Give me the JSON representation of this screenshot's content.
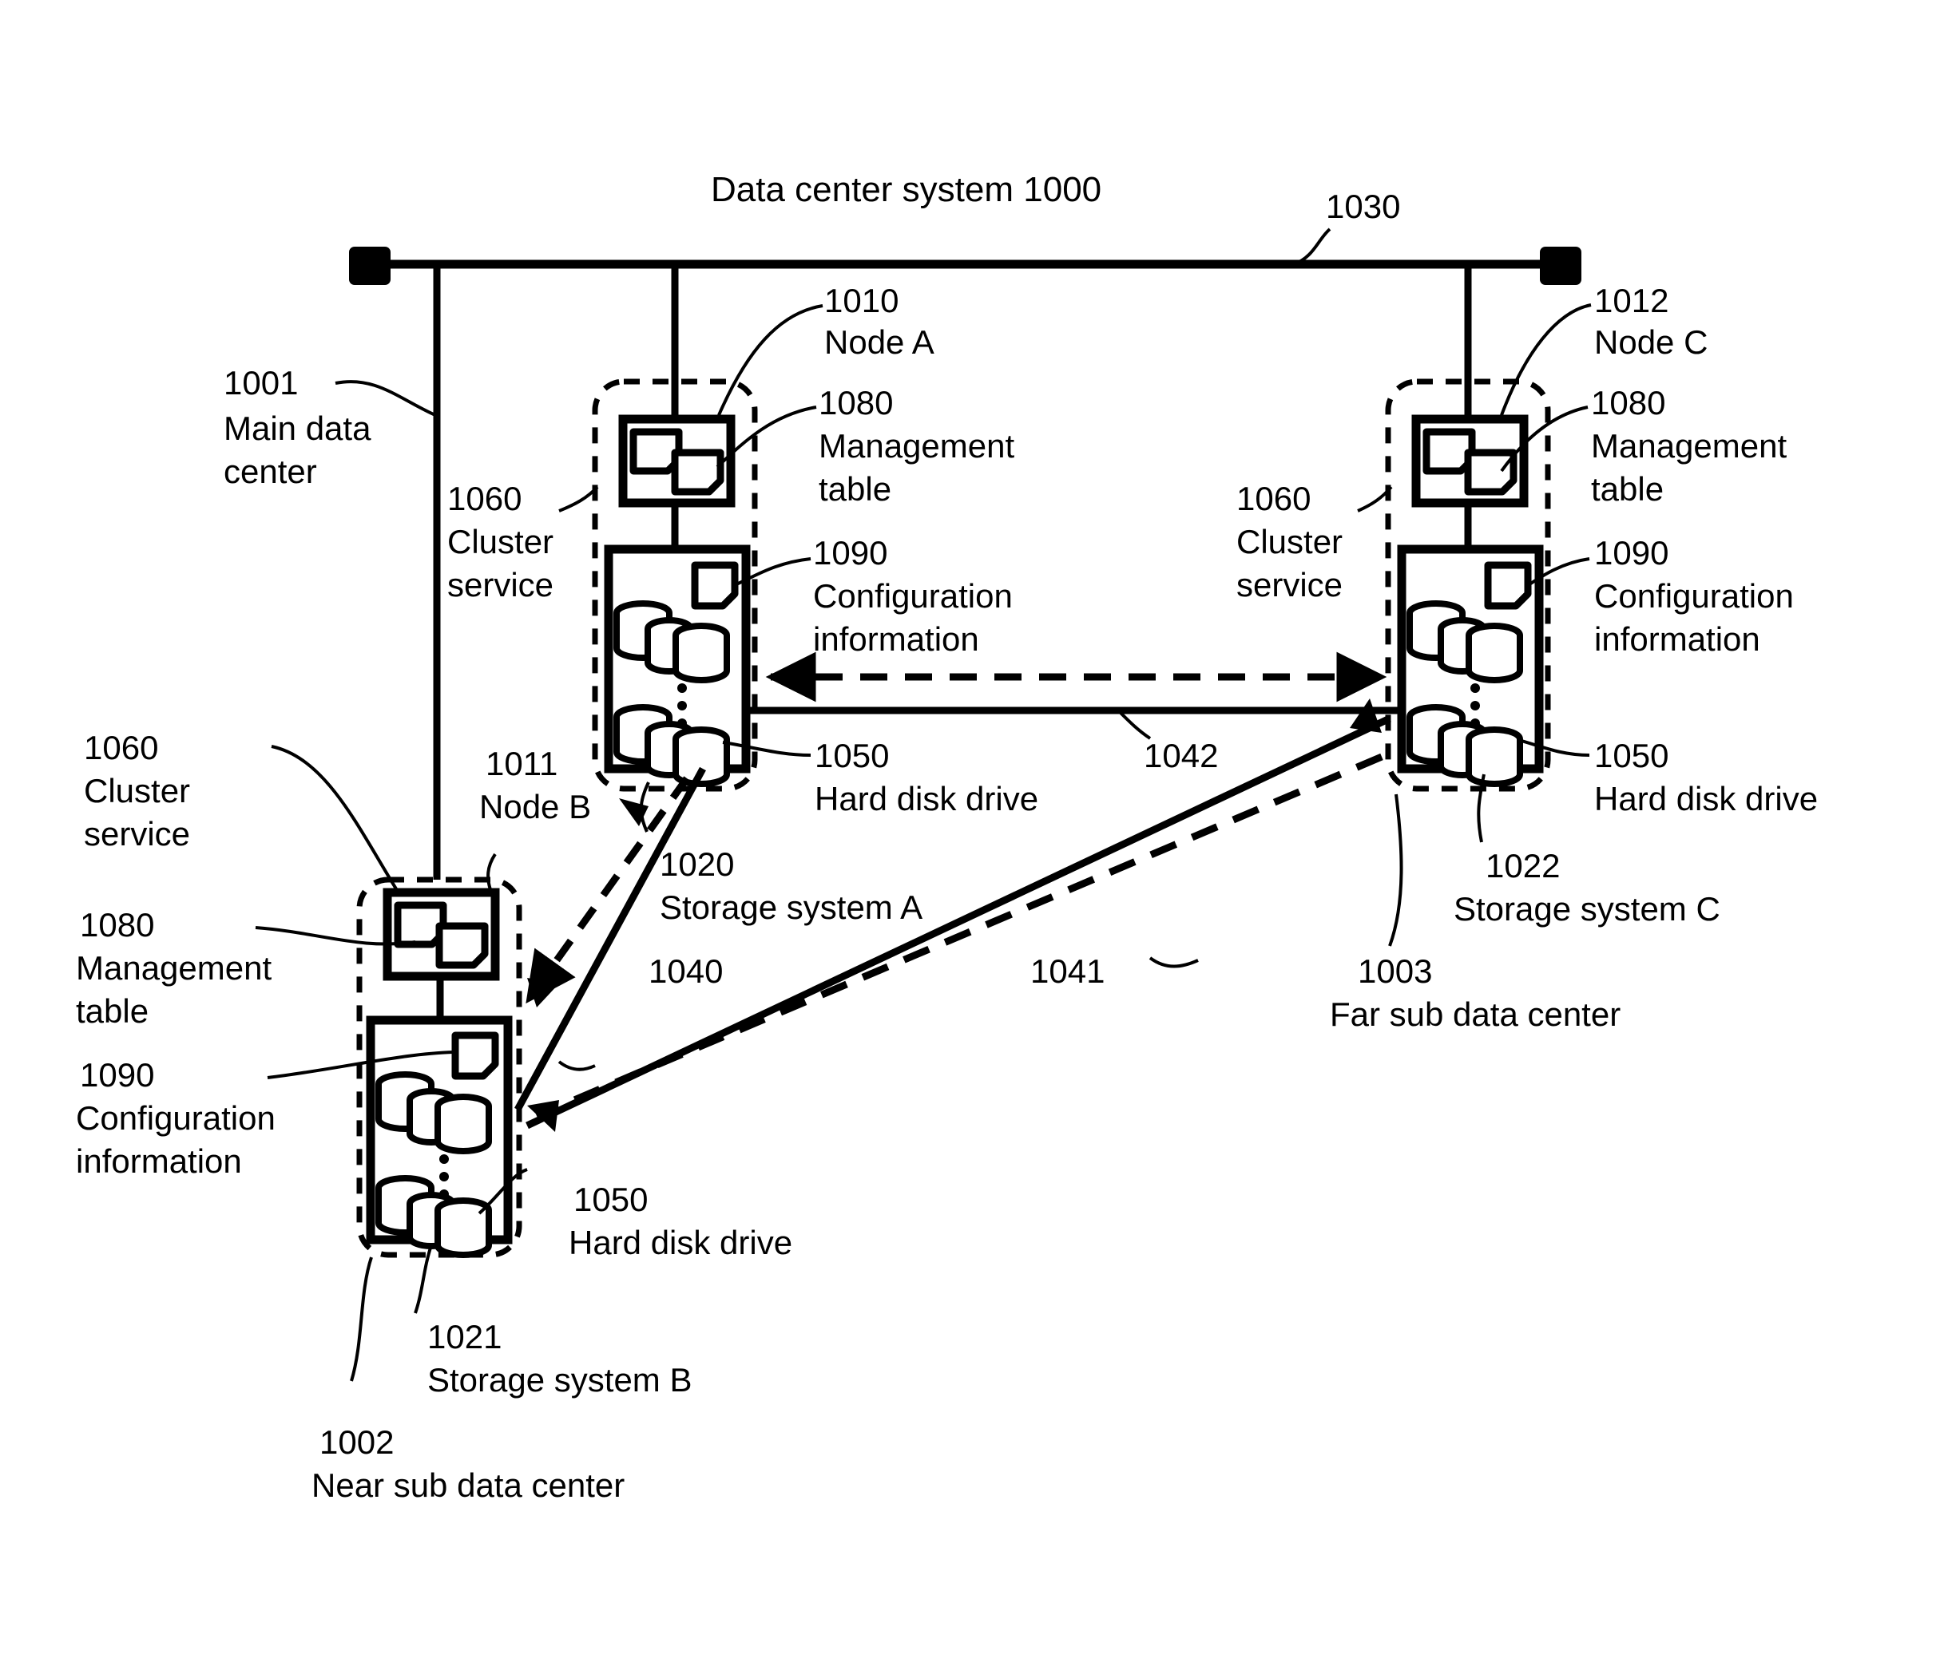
{
  "figure": {
    "title": "Data center system 1000",
    "kind": "patent-block-diagram"
  },
  "network": {
    "bus_ref": "1030",
    "terminator_left": "bus-terminator-left",
    "terminator_right": "bus-terminator-right"
  },
  "datacenters": [
    {
      "ref": "1001",
      "name": "Main data center",
      "line2": ""
    },
    {
      "ref": "1002",
      "name": "Near sub data center",
      "line2": ""
    },
    {
      "ref": "1003",
      "name": "Far sub data center",
      "line2": ""
    }
  ],
  "nodes": [
    {
      "ref": "1010",
      "name": "Node A"
    },
    {
      "ref": "1011",
      "name": "Node B"
    },
    {
      "ref": "1012",
      "name": "Node C"
    }
  ],
  "storage_systems": [
    {
      "ref": "1020",
      "name": "Storage system A"
    },
    {
      "ref": "1021",
      "name": "Storage system B"
    },
    {
      "ref": "1022",
      "name": "Storage system C"
    }
  ],
  "components": {
    "cluster_service": {
      "ref": "1060",
      "name_l1": "Cluster",
      "name_l2": "service"
    },
    "management_table": {
      "ref": "1080",
      "name_l1": "Management",
      "name_l2": "table"
    },
    "config_info": {
      "ref": "1090",
      "name_l1": "Configuration",
      "name_l2": "information"
    },
    "hard_disk_drive": {
      "ref": "1050",
      "name_l1": "Hard disk drive",
      "name_l2": ""
    }
  },
  "links": [
    {
      "ref": "1040",
      "style": "solid",
      "desc": "Storage system A to Storage system B"
    },
    {
      "ref": "1041",
      "style": "dashed",
      "desc": "Storage system B to Storage system C"
    },
    {
      "ref": "1042",
      "style": "dashed",
      "desc": "Storage system A to Storage system C"
    }
  ],
  "labels": {
    "title": "Data center system 1000",
    "ref_1030": "1030",
    "ref_1010": "1010",
    "node_a": "Node A",
    "ref_1012": "1012",
    "node_c": "Node C",
    "ref_1001": "1001",
    "main_dc_l1": "Main data",
    "main_dc_l2": "center",
    "ref_1060_a": "1060",
    "cluster_a_l1": "Cluster",
    "cluster_a_l2": "service",
    "ref_1080_a": "1080",
    "mgmt_a_l1": "Management",
    "mgmt_a_l2": "table",
    "ref_1090_a": "1090",
    "cfg_a_l1": "Configuration",
    "cfg_a_l2": "information",
    "ref_1050_a": "1050",
    "hdd_a": "Hard disk drive",
    "ref_1020": "1020",
    "storage_a": "Storage system A",
    "ref_1060_c": "1060",
    "cluster_c_l1": "Cluster",
    "cluster_c_l2": "service",
    "ref_1080_c": "1080",
    "mgmt_c_l1": "Management",
    "mgmt_c_l2": "table",
    "ref_1090_c": "1090",
    "cfg_c_l1": "Configuration",
    "cfg_c_l2": "information",
    "ref_1050_c": "1050",
    "hdd_c": "Hard disk drive",
    "ref_1022": "1022",
    "storage_c": "Storage system C",
    "ref_1003": "1003",
    "far_dc": "Far sub data center",
    "ref_1060_b": "1060",
    "cluster_b_l1": "Cluster",
    "cluster_b_l2": "service",
    "ref_1011": "1011",
    "node_b": "Node B",
    "ref_1080_b": "1080",
    "mgmt_b_l1": "Management",
    "mgmt_b_l2": "table",
    "ref_1090_b": "1090",
    "cfg_b_l1": "Configuration",
    "cfg_b_l2": "information",
    "ref_1050_b": "1050",
    "hdd_b": "Hard disk drive",
    "ref_1021": "1021",
    "storage_b": "Storage system B",
    "ref_1002": "1002",
    "near_dc": "Near sub data center",
    "ref_1040": "1040",
    "ref_1041": "1041",
    "ref_1042": "1042"
  },
  "colors": {
    "ink": "#000000",
    "paper": "#ffffff"
  }
}
